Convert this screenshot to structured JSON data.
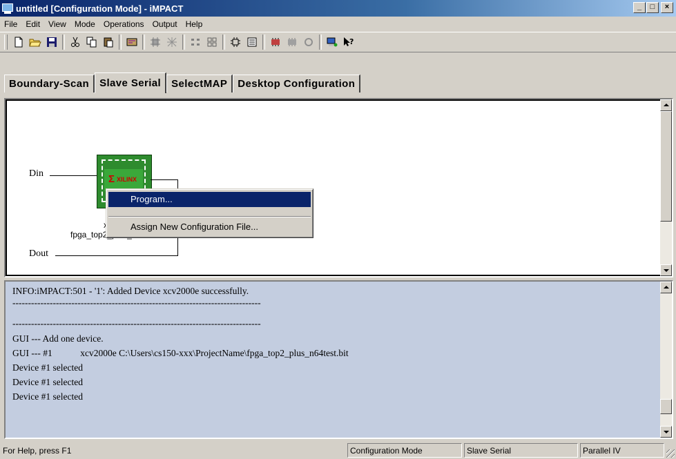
{
  "window": {
    "title": "untitled [Configuration Mode] - iMPACT"
  },
  "menu": [
    "File",
    "Edit",
    "View",
    "Mode",
    "Operations",
    "Output",
    "Help"
  ],
  "tabs": [
    {
      "label": "Boundary-Scan",
      "active": false
    },
    {
      "label": "Slave Serial",
      "active": true
    },
    {
      "label": "SelectMAP",
      "active": false
    },
    {
      "label": "Desktop Configuration",
      "active": false
    }
  ],
  "diagram": {
    "din_label": "Din",
    "dout_label": "Dout",
    "chip_logo": "XILINX",
    "device_label": "xcv2000e",
    "file_label": "fpga_top2_plus_n64test",
    "chip_color": "#2e8b2e"
  },
  "context_menu": {
    "items": [
      "Program...",
      "Assign New Configuration File..."
    ],
    "highlight_color": "#0a246a"
  },
  "log": {
    "lines": [
      "INFO:iMPACT:501 - '1': Added Device xcv2000e successfully.",
      "--------------------------------------------------------------------------------",
      "--------------------------------------------------------------------------------",
      "GUI --- Add one device.",
      "GUI --- #1            xcv2000e C:\\Users\\cs150-xxx\\ProjectName\\fpga_top2_plus_n64test.bit",
      "Device #1 selected",
      "Device #1 selected",
      "Device #1 selected"
    ],
    "background": "#c3cde0"
  },
  "status": {
    "help": "For Help, press F1",
    "mode": "Configuration Mode",
    "tab": "Slave Serial",
    "cable": "Parallel IV"
  }
}
